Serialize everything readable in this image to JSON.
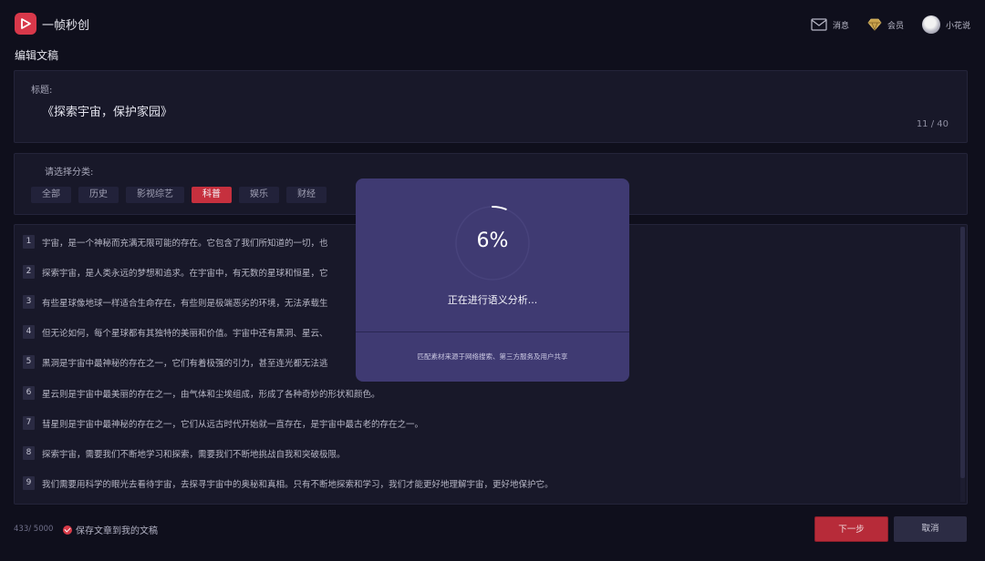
{
  "app": {
    "title": "一帧秒创"
  },
  "header": {
    "messages_label": "消息",
    "vip_label": "会员",
    "user_name": "小花说"
  },
  "page": {
    "title": "编辑文稿"
  },
  "article_title": {
    "label": "标题:",
    "value": "《探索宇宙，保护家园》",
    "count": "11 / 40"
  },
  "category": {
    "label": "请选择分类:",
    "tabs": [
      "全部",
      "历史",
      "影视综艺",
      "科普",
      "娱乐",
      "财经"
    ],
    "selected": "科普"
  },
  "content": {
    "lines": [
      {
        "num": "1",
        "text": "宇宙，是一个神秘而充满无限可能的存在。它包含了我们所知道的一切，也"
      },
      {
        "num": "2",
        "text": "探索宇宙，是人类永远的梦想和追求。在宇宙中，有无数的星球和恒星，它"
      },
      {
        "num": "3",
        "text": "有些星球像地球一样适合生命存在，有些则是极端恶劣的环境，无法承载生"
      },
      {
        "num": "4",
        "text": "但无论如何，每个星球都有其独特的美丽和价值。宇宙中还有黑洞、星云、"
      },
      {
        "num": "5",
        "text": "黑洞是宇宙中最神秘的存在之一，它们有着极强的引力，甚至连光都无法逃"
      },
      {
        "num": "6",
        "text": "星云则是宇宙中最美丽的存在之一，由气体和尘埃组成，形成了各种奇妙的形状和颜色。"
      },
      {
        "num": "7",
        "text": "彗星则是宇宙中最神秘的存在之一，它们从远古时代开始就一直存在，是宇宙中最古老的存在之一。"
      },
      {
        "num": "8",
        "text": "探索宇宙，需要我们不断地学习和探索，需要我们不断地挑战自我和突破极限。"
      },
      {
        "num": "9",
        "text": "我们需要用科学的眼光去看待宇宙，去探寻宇宙中的奥秘和真相。只有不断地探索和学习，我们才能更好地理解宇宙，更好地保护它。"
      }
    ]
  },
  "footer": {
    "char_count": "433/ 5000",
    "save_label": "保存文章到我的文稿",
    "next_label": "下一步",
    "cancel_label": "取消"
  },
  "modal": {
    "percent": "6%",
    "progress": 0.06,
    "status": "正在进行语义分析...",
    "note": "匹配素材来源于网络搜索、第三方服务及用户共享"
  },
  "colors": {
    "accent": "#c6303e",
    "background": "#0f0f1c",
    "panel": "#181829",
    "modal": "#3f3a72"
  },
  "icons": {
    "logo": "play-logo-icon",
    "messages": "envelope-icon",
    "vip": "diamond-icon",
    "save": "check-circle-icon"
  }
}
